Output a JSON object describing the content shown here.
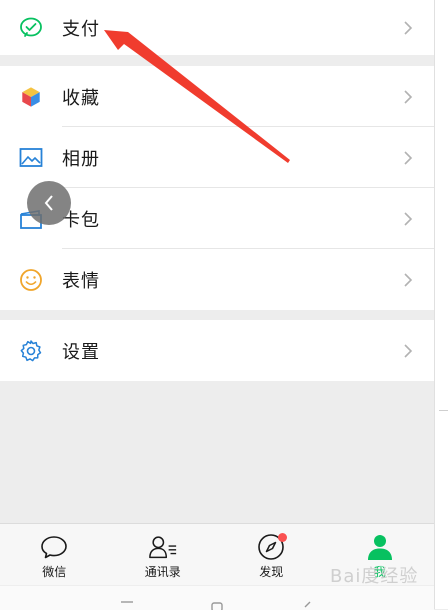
{
  "menu": {
    "pay_label": "支付",
    "favorites_label": "收藏",
    "album_label": "相册",
    "cards_label": "卡包",
    "stickers_label": "表情",
    "settings_label": "设置"
  },
  "tabbar": {
    "chats": "微信",
    "contacts": "通讯录",
    "discover": "发现",
    "me": "我"
  },
  "watermark": "Bai度经验",
  "colors": {
    "accent_green": "#07c160",
    "badge_red": "#fa5151",
    "annotation_red": "#f03c2e"
  },
  "icons": [
    "wechat-pay-icon",
    "favorites-cube-icon",
    "album-icon",
    "card-wallet-icon",
    "smile-icon",
    "gear-icon",
    "chat-bubble-icon",
    "contacts-icon",
    "compass-icon",
    "person-icon"
  ]
}
